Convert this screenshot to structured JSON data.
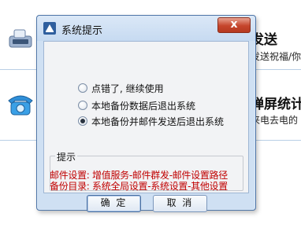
{
  "background": {
    "rows": [
      {
        "heading": "发送",
        "subtext": "发送祝福/你"
      },
      {
        "heading": "弹屏统计",
        "subtext": "来电去电的"
      }
    ]
  },
  "dialog": {
    "title": "系统提示",
    "close_label": "x",
    "options": [
      {
        "label": "点错了, 继续使用",
        "checked": false
      },
      {
        "label": "本地备份数据后退出系统",
        "checked": false
      },
      {
        "label": "本地备份并邮件发送后退出系统",
        "checked": true
      }
    ],
    "hint": {
      "title": "提示",
      "lines": [
        "邮件设置: 增值服务-邮件群发-邮件设置路径",
        "备份目录: 系统全局设置-系统设置-其他设置"
      ]
    },
    "buttons": {
      "ok": "确 定",
      "cancel": "取 消"
    }
  },
  "colors": {
    "hint_text": "#c00000",
    "dialog_frame": "#cfe0f3",
    "close_button": "#c5452b"
  }
}
